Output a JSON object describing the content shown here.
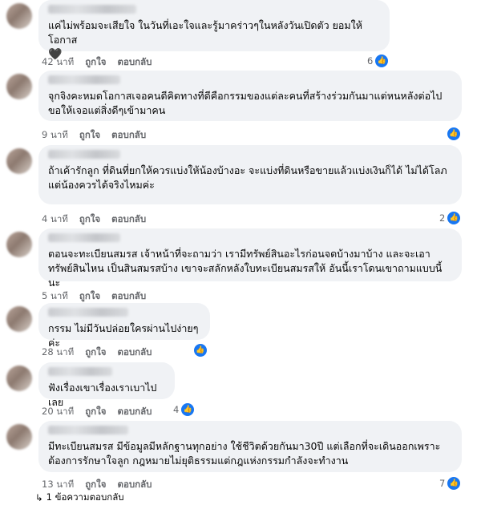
{
  "comments": [
    {
      "text": "แค่ไม่พร้อมจะเสียใจ ในวันที่เอะใจและรู้มาคร่าวๆในหลังวันเปิดตัว ยอมให้โอกาส",
      "emoji": "🖤",
      "time": "42 นาที",
      "like": "ถูกใจ",
      "reply": "ตอบกลับ",
      "reactions": "6"
    },
    {
      "text": "จุกจิงคะหมดโอกาสเจอคนดีคิดทางที่ดีคือกรรมของแต่ละคนที่สร้างร่วมกันมาแต่หนหลังต่อไปขอให้เจอแต่สิ่งดีๆเข้ามาคน",
      "time": "9 นาที",
      "like": "ถูกใจ",
      "reply": "ตอบกลับ",
      "reactions": ""
    },
    {
      "text": "ถ้าเค้ารักลูก ที่ดินที่ยกให้ควรแบ่งให้น้องบ้างอะ จะแบ่งที่ดินหรือขายแล้วแบ่งเงินก็ได้ ไม่ได้โลภ แต่น้องควรได้จริงไหมค่ะ",
      "time": "4 นาที",
      "like": "ถูกใจ",
      "reply": "ตอบกลับ",
      "reactions": "2"
    },
    {
      "text": "ตอนจะทะเบียนสมรส เจ้าหน้าที่จะถามว่า เรามีทรัพย์สินอะไรก่อนจดบ้างมาบ้าง และจะเอาทรัพย์สินไหน เป็นสินสมรสบ้าง เขาจะสลักหลังใบทะเบียนสมรสให้ อันนี้เราโดนเขาถามแบบนี้นะ",
      "time": "5 นาที",
      "like": "ถูกใจ",
      "reply": "ตอบกลับ",
      "reactions": ""
    },
    {
      "text": "กรรม ไม่มีวันปล่อยใครผ่านไปง่ายๆค่ะ",
      "time": "28 นาที",
      "like": "ถูกใจ",
      "reply": "ตอบกลับ",
      "reactions": ""
    },
    {
      "text": "ฟังเรื่องเขาเรื่องเราเบาไปเลย",
      "time": "20 นาที",
      "like": "ถูกใจ",
      "reply": "ตอบกลับ",
      "reactions": "4"
    },
    {
      "text": "มีทะเบียนสมรส มีข้อมูลมีหลักฐานทุกอย่าง ใช้ชีวิตด้วยกันมา30ปี แต่เลือกที่จะเดินออกเพราะต้องการรักษาใจลูก กฎหมายไม่ยุติธรรมแต่กฎแห่งกรรมกำลังจะทำงาน",
      "time": "13 นาที",
      "like": "ถูกใจ",
      "reply": "ตอบกลับ",
      "reactions": "7"
    }
  ],
  "more_replies": "1 ข้อความตอบกลับ",
  "colors": {
    "bubble": "#f0f2f5",
    "meta": "#65676b",
    "like_blue": "#1877f2"
  },
  "icons": {
    "like": "thumbs-up-icon",
    "reply_arrow": "reply-arrow-icon"
  }
}
